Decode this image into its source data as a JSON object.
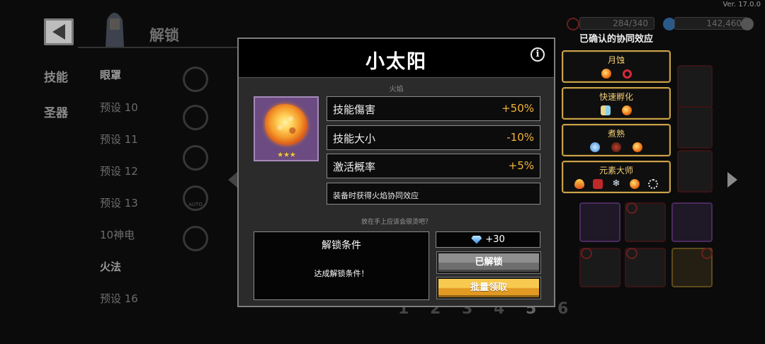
{
  "version": "Ver. 17.0.0",
  "resources": {
    "energy": "284/340",
    "gems": "142,460"
  },
  "header": {
    "title": "解锁"
  },
  "side_tabs": [
    "技能",
    "圣器"
  ],
  "presets": [
    "眼罩",
    "预设 10",
    "预设 11",
    "预设 12",
    "预设 13",
    "10神电",
    "火法",
    "预设 16"
  ],
  "bg_icon_auto_label": "AUTO",
  "pages": [
    "1",
    "2",
    "3",
    "4",
    "5",
    "6"
  ],
  "synergy": {
    "header": "已确认的协同效应",
    "cards": [
      {
        "name": "月蚀",
        "icons": [
          "fire",
          "ring"
        ]
      },
      {
        "name": "快速孵化",
        "icons": [
          "eggs",
          "fire"
        ]
      },
      {
        "name": "煮熟",
        "icons": [
          "blue",
          "dark",
          "fire"
        ]
      },
      {
        "name": "元素大师",
        "icons": [
          "flame",
          "heart",
          "snow",
          "fire",
          "swirl"
        ]
      }
    ]
  },
  "modal": {
    "title": "小太阳",
    "subtitle": "火焰",
    "item_stars": "★★★",
    "stats": [
      {
        "label": "技能傷害",
        "value": "+50%"
      },
      {
        "label": "技能大小",
        "value": "-10%"
      },
      {
        "label": "激活概率",
        "value": "+5%"
      }
    ],
    "equip_note": "装备时获得火焰协同效应",
    "hint": "放在手上应该会很烫吧？",
    "unlock_title": "解锁条件",
    "unlock_text": "达成解锁条件！",
    "gem_reward": "+30",
    "unlocked_label": "已解锁",
    "bulk_claim_label": "批量领取"
  },
  "colors": {
    "accent_gold": "#f2b43a",
    "synergy_border": "#c9a24a",
    "item_bg": "#6b4b82"
  }
}
